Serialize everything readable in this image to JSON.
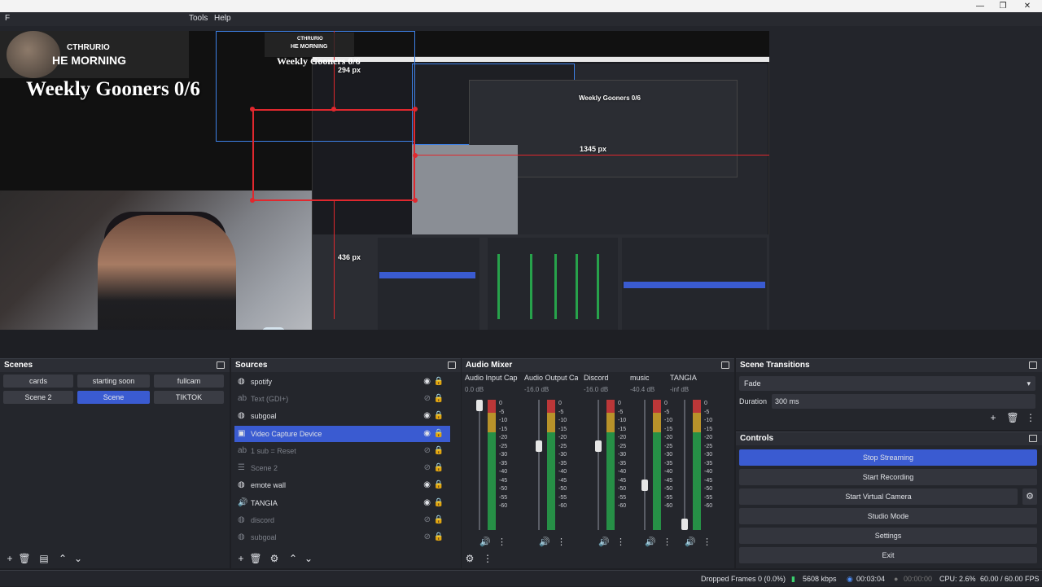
{
  "menu": {
    "file": "F",
    "tools": "Tools",
    "help": "Help"
  },
  "overlay": {
    "name": "CTHRURIO",
    "subtitle": "HE MORNING",
    "goal": "Weekly Gooners 0/6"
  },
  "nested_overlay": {
    "name": "CTHRURIO",
    "subtitle": "HE MORNING",
    "goal": "Weekly Gooners 0/6",
    "goal_small": "Weekly Gooners 0/6"
  },
  "guides": {
    "top": "294 px",
    "right": "1345 px",
    "left": "436 px"
  },
  "scenes": {
    "title": "Scenes",
    "items": [
      {
        "label": "cards",
        "active": false
      },
      {
        "label": "starting soon",
        "active": false
      },
      {
        "label": "fullcam",
        "active": false
      },
      {
        "label": "Scene 2",
        "active": false
      },
      {
        "label": "Scene",
        "active": true
      },
      {
        "label": "TIKTOK",
        "active": false
      }
    ]
  },
  "sources": {
    "title": "Sources",
    "items": [
      {
        "label": "spotify",
        "icon": "globe-icon",
        "visible": true
      },
      {
        "label": "Text (GDI+)",
        "icon": "text-icon",
        "visible": false
      },
      {
        "label": "subgoal",
        "icon": "globe-icon",
        "visible": true
      },
      {
        "label": "Video Capture Device",
        "icon": "camera-icon",
        "visible": true,
        "active": true
      },
      {
        "label": "1 sub = Reset",
        "icon": "text-icon",
        "visible": false
      },
      {
        "label": "Scene 2",
        "icon": "list-icon",
        "visible": false
      },
      {
        "label": "emote wall",
        "icon": "globe-icon",
        "visible": true
      },
      {
        "label": "TANGIA",
        "icon": "speaker-icon",
        "visible": true
      },
      {
        "label": "discord",
        "icon": "globe-icon",
        "visible": false
      },
      {
        "label": "subgoal",
        "icon": "globe-icon",
        "visible": false
      }
    ]
  },
  "mixer": {
    "title": "Audio Mixer",
    "channels": [
      {
        "name": "Audio Input Cap",
        "db": "0.0 dB",
        "level": 1.0
      },
      {
        "name": "Audio Output Ca",
        "db": "-16.0 dB",
        "level": 0.66
      },
      {
        "name": "Discord",
        "db": "-16.0 dB",
        "level": 0.66
      },
      {
        "name": "music",
        "db": "-40.4 dB",
        "level": 0.33
      },
      {
        "name": "TANGIA",
        "db": "-inf dB",
        "level": 0.0
      }
    ],
    "scale": [
      "0",
      "-5",
      "-10",
      "-15",
      "-20",
      "-25",
      "-30",
      "-35",
      "-40",
      "-45",
      "-50",
      "-55",
      "-60"
    ]
  },
  "transitions": {
    "title": "Scene Transitions",
    "selected": "Fade",
    "duration_label": "Duration",
    "duration_value": "300 ms"
  },
  "controls": {
    "title": "Controls",
    "buttons": [
      {
        "label": "Stop Streaming",
        "active": true
      },
      {
        "label": "Start Recording",
        "active": false
      },
      {
        "label": "Start Virtual Camera",
        "active": false
      },
      {
        "label": "Studio Mode",
        "active": false
      },
      {
        "label": "Settings",
        "active": false
      },
      {
        "label": "Exit",
        "active": false
      }
    ]
  },
  "status": {
    "dropped": "Dropped Frames 0 (0.0%)",
    "bitrate": "5608 kbps",
    "stream_time": "00:03:04",
    "rec_time": "00:00:00",
    "cpu": "CPU: 2.6%",
    "fps": "60.00 / 60.00 FPS"
  },
  "colors": {
    "accent": "#3a5bd1",
    "guide": "#e0282e",
    "panel": "#24262c"
  }
}
